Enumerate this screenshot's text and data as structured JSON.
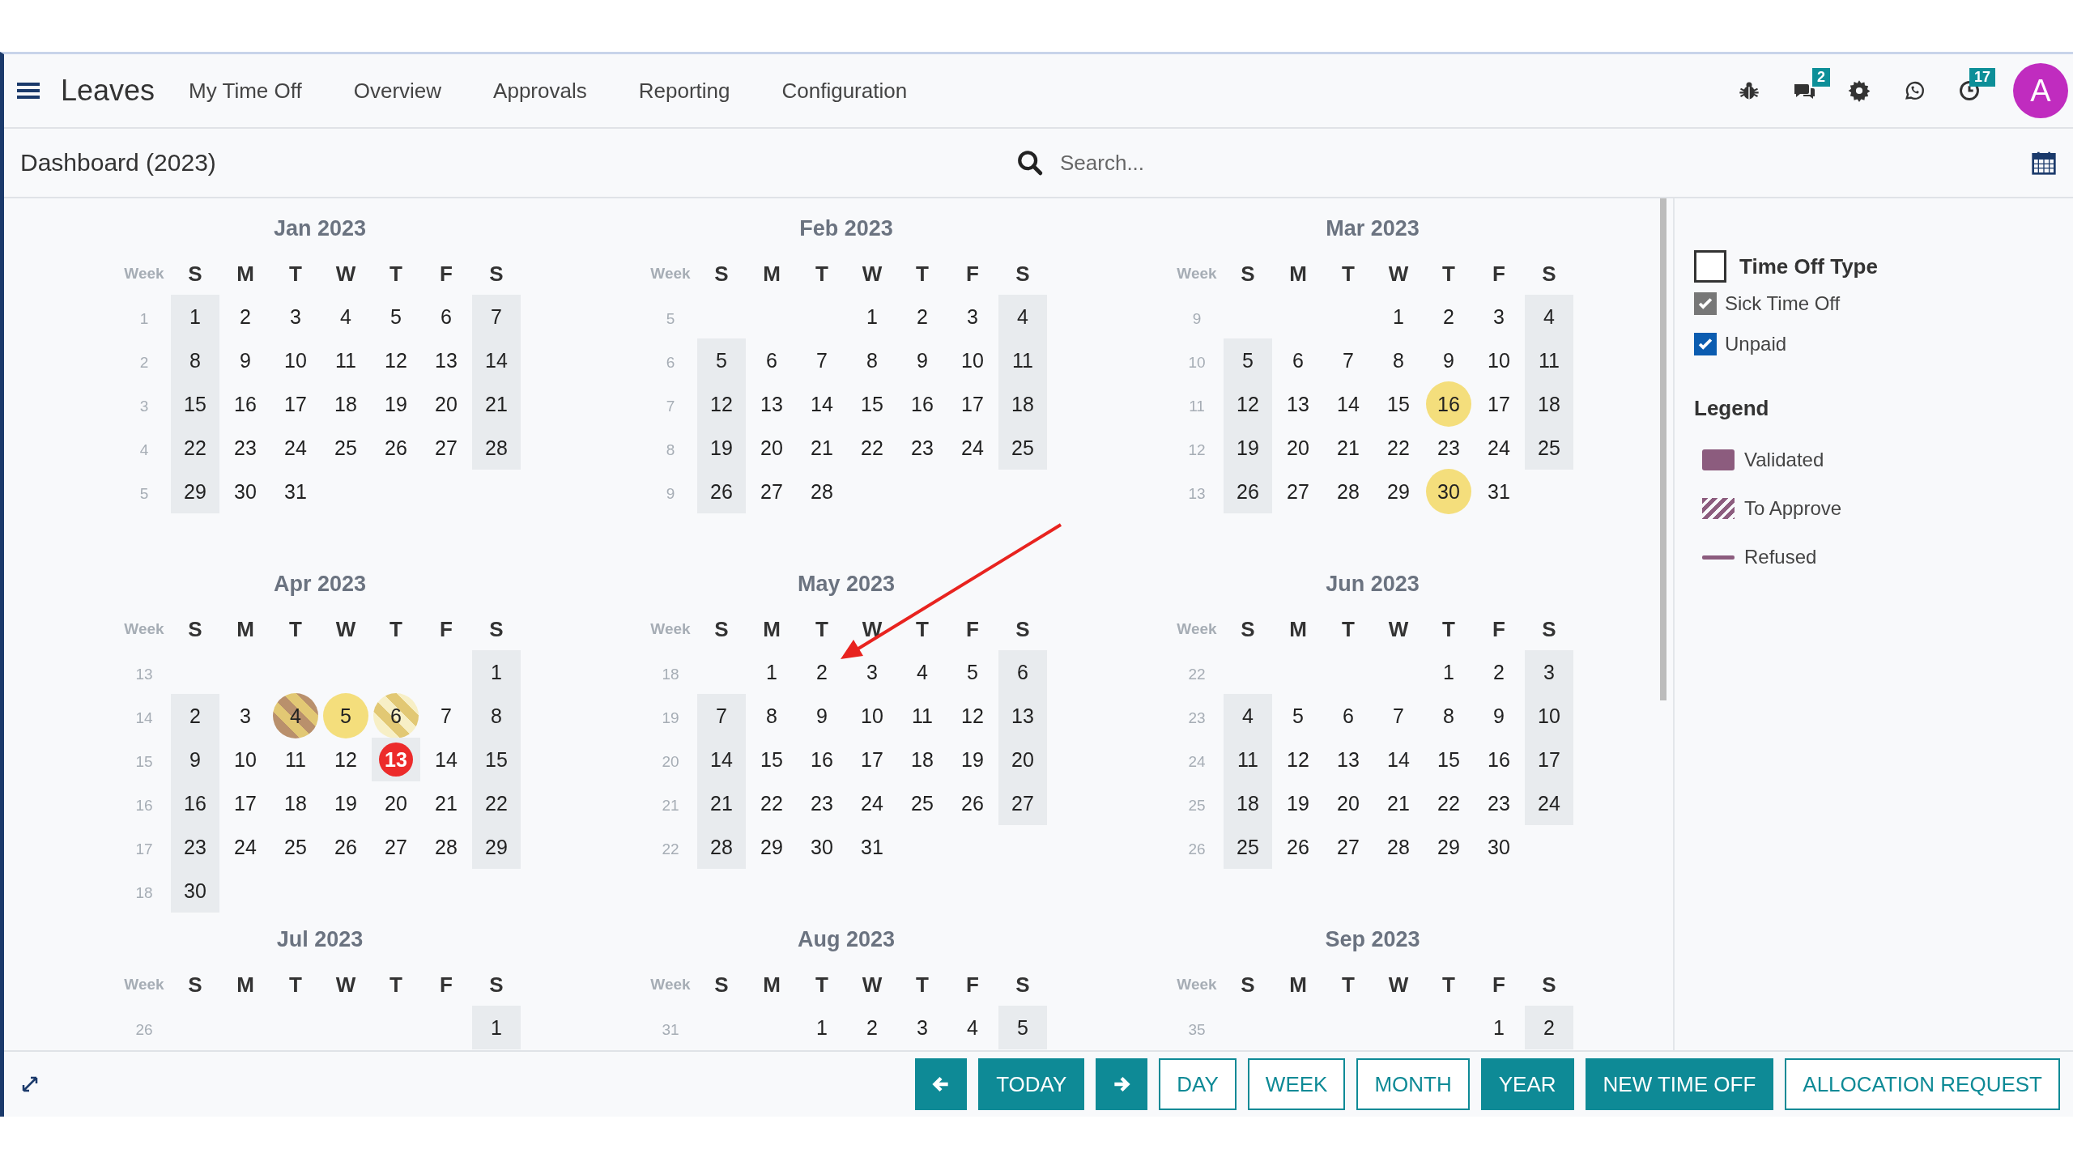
{
  "app": {
    "title": "Leaves",
    "menu": [
      "My Time Off",
      "Overview",
      "Approvals",
      "Reporting",
      "Configuration"
    ]
  },
  "systray": {
    "chat_badge": "2",
    "activity_badge": "17",
    "avatar": "A"
  },
  "control_panel": {
    "breadcrumb": "Dashboard (2023)",
    "search": {
      "placeholder": "Search..."
    }
  },
  "months": [
    {
      "title": "Jan 2023",
      "week_label": "Week",
      "weekdays": [
        "S",
        "M",
        "T",
        "W",
        "T",
        "F",
        "S"
      ],
      "weeks": [
        {
          "number": "1",
          "days": [
            {
              "kind": "day",
              "day": "1"
            },
            {
              "kind": "day",
              "day": "2"
            },
            {
              "kind": "day",
              "day": "3"
            },
            {
              "kind": "day",
              "day": "4"
            },
            {
              "kind": "day",
              "day": "5"
            },
            {
              "kind": "day",
              "day": "6"
            },
            {
              "kind": "day",
              "day": "7"
            }
          ]
        },
        {
          "number": "2",
          "days": [
            {
              "kind": "day",
              "day": "8"
            },
            {
              "kind": "day",
              "day": "9"
            },
            {
              "kind": "day",
              "day": "10"
            },
            {
              "kind": "day",
              "day": "11"
            },
            {
              "kind": "day",
              "day": "12"
            },
            {
              "kind": "day",
              "day": "13"
            },
            {
              "kind": "day",
              "day": "14"
            }
          ]
        },
        {
          "number": "3",
          "days": [
            {
              "kind": "day",
              "day": "15"
            },
            {
              "kind": "day",
              "day": "16"
            },
            {
              "kind": "day",
              "day": "17"
            },
            {
              "kind": "day",
              "day": "18"
            },
            {
              "kind": "day",
              "day": "19"
            },
            {
              "kind": "day",
              "day": "20"
            },
            {
              "kind": "day",
              "day": "21"
            }
          ]
        },
        {
          "number": "4",
          "days": [
            {
              "kind": "day",
              "day": "22"
            },
            {
              "kind": "day",
              "day": "23"
            },
            {
              "kind": "day",
              "day": "24"
            },
            {
              "kind": "day",
              "day": "25"
            },
            {
              "kind": "day",
              "day": "26"
            },
            {
              "kind": "day",
              "day": "27"
            },
            {
              "kind": "day",
              "day": "28"
            }
          ]
        },
        {
          "number": "5",
          "days": [
            {
              "kind": "day",
              "day": "29"
            },
            {
              "kind": "day",
              "day": "30"
            },
            {
              "kind": "day",
              "day": "31"
            }
          ]
        }
      ]
    },
    {
      "title": "Feb 2023",
      "week_label": "Week",
      "weekdays": [
        "S",
        "M",
        "T",
        "W",
        "T",
        "F",
        "S"
      ],
      "weeks": [
        {
          "number": "5",
          "days": [
            {
              "kind": "blank"
            },
            {
              "kind": "blank"
            },
            {
              "kind": "blank"
            },
            {
              "kind": "day",
              "day": "1"
            },
            {
              "kind": "day",
              "day": "2"
            },
            {
              "kind": "day",
              "day": "3"
            },
            {
              "kind": "day",
              "day": "4"
            }
          ]
        },
        {
          "number": "6",
          "days": [
            {
              "kind": "day",
              "day": "5"
            },
            {
              "kind": "day",
              "day": "6"
            },
            {
              "kind": "day",
              "day": "7"
            },
            {
              "kind": "day",
              "day": "8"
            },
            {
              "kind": "day",
              "day": "9"
            },
            {
              "kind": "day",
              "day": "10"
            },
            {
              "kind": "day",
              "day": "11"
            }
          ]
        },
        {
          "number": "7",
          "days": [
            {
              "kind": "day",
              "day": "12"
            },
            {
              "kind": "day",
              "day": "13"
            },
            {
              "kind": "day",
              "day": "14"
            },
            {
              "kind": "day",
              "day": "15"
            },
            {
              "kind": "day",
              "day": "16"
            },
            {
              "kind": "day",
              "day": "17"
            },
            {
              "kind": "day",
              "day": "18"
            }
          ]
        },
        {
          "number": "8",
          "days": [
            {
              "kind": "day",
              "day": "19"
            },
            {
              "kind": "day",
              "day": "20"
            },
            {
              "kind": "day",
              "day": "21"
            },
            {
              "kind": "day",
              "day": "22"
            },
            {
              "kind": "day",
              "day": "23"
            },
            {
              "kind": "day",
              "day": "24"
            },
            {
              "kind": "day",
              "day": "25"
            }
          ]
        },
        {
          "number": "9",
          "days": [
            {
              "kind": "day",
              "day": "26"
            },
            {
              "kind": "day",
              "day": "27"
            },
            {
              "kind": "day",
              "day": "28"
            }
          ]
        }
      ]
    },
    {
      "title": "Mar 2023",
      "week_label": "Week",
      "weekdays": [
        "S",
        "M",
        "T",
        "W",
        "T",
        "F",
        "S"
      ],
      "weeks": [
        {
          "number": "9",
          "days": [
            {
              "kind": "blank"
            },
            {
              "kind": "blank"
            },
            {
              "kind": "blank"
            },
            {
              "kind": "day",
              "day": "1"
            },
            {
              "kind": "day",
              "day": "2"
            },
            {
              "kind": "day",
              "day": "3"
            },
            {
              "kind": "day",
              "day": "4"
            }
          ]
        },
        {
          "number": "10",
          "days": [
            {
              "kind": "day",
              "day": "5"
            },
            {
              "kind": "day",
              "day": "6"
            },
            {
              "kind": "day",
              "day": "7"
            },
            {
              "kind": "day",
              "day": "8"
            },
            {
              "kind": "day",
              "day": "9"
            },
            {
              "kind": "day",
              "day": "10"
            },
            {
              "kind": "day",
              "day": "11"
            }
          ]
        },
        {
          "number": "11",
          "days": [
            {
              "kind": "day",
              "day": "12"
            },
            {
              "kind": "day",
              "day": "13"
            },
            {
              "kind": "day",
              "day": "14"
            },
            {
              "kind": "day",
              "day": "15"
            },
            {
              "kind": "day",
              "day": "16",
              "time_off": true,
              "color": "#f4de7c"
            },
            {
              "kind": "day",
              "day": "17"
            },
            {
              "kind": "day",
              "day": "18"
            }
          ]
        },
        {
          "number": "12",
          "days": [
            {
              "kind": "day",
              "day": "19"
            },
            {
              "kind": "day",
              "day": "20"
            },
            {
              "kind": "day",
              "day": "21"
            },
            {
              "kind": "day",
              "day": "22"
            },
            {
              "kind": "day",
              "day": "23"
            },
            {
              "kind": "day",
              "day": "24"
            },
            {
              "kind": "day",
              "day": "25"
            }
          ]
        },
        {
          "number": "13",
          "days": [
            {
              "kind": "day",
              "day": "26"
            },
            {
              "kind": "day",
              "day": "27"
            },
            {
              "kind": "day",
              "day": "28"
            },
            {
              "kind": "day",
              "day": "29"
            },
            {
              "kind": "day",
              "day": "30",
              "time_off": true,
              "color": "#f4de7c"
            },
            {
              "kind": "day",
              "day": "31"
            }
          ]
        }
      ]
    },
    {
      "title": "Apr 2023",
      "week_label": "Week",
      "weekdays": [
        "S",
        "M",
        "T",
        "W",
        "T",
        "F",
        "S"
      ],
      "weeks": [
        {
          "number": "13",
          "days": [
            {
              "kind": "blank"
            },
            {
              "kind": "blank"
            },
            {
              "kind": "blank"
            },
            {
              "kind": "blank"
            },
            {
              "kind": "blank"
            },
            {
              "kind": "blank"
            },
            {
              "kind": "day",
              "day": "1"
            }
          ]
        },
        {
          "number": "14",
          "days": [
            {
              "kind": "day",
              "day": "2"
            },
            {
              "kind": "day",
              "day": "3"
            },
            {
              "kind": "day",
              "day": "4",
              "time_off": true,
              "to_approve": true,
              "color": "#b9906c"
            },
            {
              "kind": "day",
              "day": "5",
              "time_off": true,
              "color": "#f4de7c"
            },
            {
              "kind": "day",
              "day": "6",
              "time_off": true,
              "to_approve": true,
              "color": "#f7efc6"
            },
            {
              "kind": "day",
              "day": "7"
            },
            {
              "kind": "day",
              "day": "8"
            }
          ]
        },
        {
          "number": "15",
          "days": [
            {
              "kind": "day",
              "day": "9"
            },
            {
              "kind": "day",
              "day": "10"
            },
            {
              "kind": "day",
              "day": "11"
            },
            {
              "kind": "day",
              "day": "12"
            },
            {
              "kind": "day",
              "day": "13",
              "today": true
            },
            {
              "kind": "day",
              "day": "14"
            },
            {
              "kind": "day",
              "day": "15"
            }
          ]
        },
        {
          "number": "16",
          "days": [
            {
              "kind": "day",
              "day": "16"
            },
            {
              "kind": "day",
              "day": "17"
            },
            {
              "kind": "day",
              "day": "18"
            },
            {
              "kind": "day",
              "day": "19"
            },
            {
              "kind": "day",
              "day": "20"
            },
            {
              "kind": "day",
              "day": "21"
            },
            {
              "kind": "day",
              "day": "22"
            }
          ]
        },
        {
          "number": "17",
          "days": [
            {
              "kind": "day",
              "day": "23"
            },
            {
              "kind": "day",
              "day": "24"
            },
            {
              "kind": "day",
              "day": "25"
            },
            {
              "kind": "day",
              "day": "26"
            },
            {
              "kind": "day",
              "day": "27"
            },
            {
              "kind": "day",
              "day": "28"
            },
            {
              "kind": "day",
              "day": "29"
            }
          ]
        },
        {
          "number": "18",
          "days": [
            {
              "kind": "day",
              "day": "30"
            }
          ]
        }
      ]
    },
    {
      "title": "May 2023",
      "week_label": "Week",
      "weekdays": [
        "S",
        "M",
        "T",
        "W",
        "T",
        "F",
        "S"
      ],
      "weeks": [
        {
          "number": "18",
          "days": [
            {
              "kind": "blank"
            },
            {
              "kind": "day",
              "day": "1"
            },
            {
              "kind": "day",
              "day": "2"
            },
            {
              "kind": "day",
              "day": "3"
            },
            {
              "kind": "day",
              "day": "4"
            },
            {
              "kind": "day",
              "day": "5"
            },
            {
              "kind": "day",
              "day": "6"
            }
          ]
        },
        {
          "number": "19",
          "days": [
            {
              "kind": "day",
              "day": "7"
            },
            {
              "kind": "day",
              "day": "8"
            },
            {
              "kind": "day",
              "day": "9"
            },
            {
              "kind": "day",
              "day": "10"
            },
            {
              "kind": "day",
              "day": "11"
            },
            {
              "kind": "day",
              "day": "12"
            },
            {
              "kind": "day",
              "day": "13"
            }
          ]
        },
        {
          "number": "20",
          "days": [
            {
              "kind": "day",
              "day": "14"
            },
            {
              "kind": "day",
              "day": "15"
            },
            {
              "kind": "day",
              "day": "16"
            },
            {
              "kind": "day",
              "day": "17"
            },
            {
              "kind": "day",
              "day": "18"
            },
            {
              "kind": "day",
              "day": "19"
            },
            {
              "kind": "day",
              "day": "20"
            }
          ]
        },
        {
          "number": "21",
          "days": [
            {
              "kind": "day",
              "day": "21"
            },
            {
              "kind": "day",
              "day": "22"
            },
            {
              "kind": "day",
              "day": "23"
            },
            {
              "kind": "day",
              "day": "24"
            },
            {
              "kind": "day",
              "day": "25"
            },
            {
              "kind": "day",
              "day": "26"
            },
            {
              "kind": "day",
              "day": "27"
            }
          ]
        },
        {
          "number": "22",
          "days": [
            {
              "kind": "day",
              "day": "28"
            },
            {
              "kind": "day",
              "day": "29"
            },
            {
              "kind": "day",
              "day": "30"
            },
            {
              "kind": "day",
              "day": "31"
            }
          ]
        }
      ]
    },
    {
      "title": "Jun 2023",
      "week_label": "Week",
      "weekdays": [
        "S",
        "M",
        "T",
        "W",
        "T",
        "F",
        "S"
      ],
      "weeks": [
        {
          "number": "22",
          "days": [
            {
              "kind": "blank"
            },
            {
              "kind": "blank"
            },
            {
              "kind": "blank"
            },
            {
              "kind": "blank"
            },
            {
              "kind": "day",
              "day": "1"
            },
            {
              "kind": "day",
              "day": "2"
            },
            {
              "kind": "day",
              "day": "3"
            }
          ]
        },
        {
          "number": "23",
          "days": [
            {
              "kind": "day",
              "day": "4"
            },
            {
              "kind": "day",
              "day": "5"
            },
            {
              "kind": "day",
              "day": "6"
            },
            {
              "kind": "day",
              "day": "7"
            },
            {
              "kind": "day",
              "day": "8"
            },
            {
              "kind": "day",
              "day": "9"
            },
            {
              "kind": "day",
              "day": "10"
            }
          ]
        },
        {
          "number": "24",
          "days": [
            {
              "kind": "day",
              "day": "11"
            },
            {
              "kind": "day",
              "day": "12"
            },
            {
              "kind": "day",
              "day": "13"
            },
            {
              "kind": "day",
              "day": "14"
            },
            {
              "kind": "day",
              "day": "15"
            },
            {
              "kind": "day",
              "day": "16"
            },
            {
              "kind": "day",
              "day": "17"
            }
          ]
        },
        {
          "number": "25",
          "days": [
            {
              "kind": "day",
              "day": "18"
            },
            {
              "kind": "day",
              "day": "19"
            },
            {
              "kind": "day",
              "day": "20"
            },
            {
              "kind": "day",
              "day": "21"
            },
            {
              "kind": "day",
              "day": "22"
            },
            {
              "kind": "day",
              "day": "23"
            },
            {
              "kind": "day",
              "day": "24"
            }
          ]
        },
        {
          "number": "26",
          "days": [
            {
              "kind": "day",
              "day": "25"
            },
            {
              "kind": "day",
              "day": "26"
            },
            {
              "kind": "day",
              "day": "27"
            },
            {
              "kind": "day",
              "day": "28"
            },
            {
              "kind": "day",
              "day": "29"
            },
            {
              "kind": "day",
              "day": "30"
            }
          ]
        }
      ]
    },
    {
      "title": "Jul 2023",
      "week_label": "Week",
      "weekdays": [
        "S",
        "M",
        "T",
        "W",
        "T",
        "F",
        "S"
      ],
      "weeks": [
        {
          "number": "26",
          "days": [
            {
              "kind": "blank"
            },
            {
              "kind": "blank"
            },
            {
              "kind": "blank"
            },
            {
              "kind": "blank"
            },
            {
              "kind": "blank"
            },
            {
              "kind": "blank"
            },
            {
              "kind": "day",
              "day": "1"
            }
          ]
        }
      ]
    },
    {
      "title": "Aug 2023",
      "week_label": "Week",
      "weekdays": [
        "S",
        "M",
        "T",
        "W",
        "T",
        "F",
        "S"
      ],
      "weeks": [
        {
          "number": "31",
          "days": [
            {
              "kind": "blank"
            },
            {
              "kind": "blank"
            },
            {
              "kind": "day",
              "day": "1"
            },
            {
              "kind": "day",
              "day": "2"
            },
            {
              "kind": "day",
              "day": "3"
            },
            {
              "kind": "day",
              "day": "4"
            },
            {
              "kind": "day",
              "day": "5"
            }
          ]
        }
      ]
    },
    {
      "title": "Sep 2023",
      "week_label": "Week",
      "weekdays": [
        "S",
        "M",
        "T",
        "W",
        "T",
        "F",
        "S"
      ],
      "weeks": [
        {
          "number": "35",
          "days": [
            {
              "kind": "blank"
            },
            {
              "kind": "blank"
            },
            {
              "kind": "blank"
            },
            {
              "kind": "blank"
            },
            {
              "kind": "blank"
            },
            {
              "kind": "day",
              "day": "1"
            },
            {
              "kind": "day",
              "day": "2"
            }
          ]
        }
      ]
    }
  ],
  "filter": {
    "title": "Time Off Type",
    "checked": false,
    "types": [
      {
        "label": "Sick Time Off",
        "checked": true,
        "color": "#777777"
      },
      {
        "label": "Unpaid",
        "checked": true,
        "color": "#0b5cb0"
      }
    ]
  },
  "legend": {
    "title": "Legend",
    "items": [
      {
        "kind": "validated",
        "label": "Validated"
      },
      {
        "kind": "to-approve",
        "label": "To Approve"
      },
      {
        "kind": "refused",
        "label": "Refused"
      }
    ]
  },
  "bottom_bar": {
    "today": "TODAY",
    "scales": [
      {
        "label": "DAY",
        "selected": false
      },
      {
        "label": "WEEK",
        "selected": false
      },
      {
        "label": "MONTH",
        "selected": false
      },
      {
        "label": "YEAR",
        "selected": true
      }
    ],
    "actions": [
      {
        "label": "NEW TIME OFF",
        "kind": "primary"
      },
      {
        "label": "ALLOCATION REQUEST",
        "kind": "secondary"
      }
    ]
  }
}
